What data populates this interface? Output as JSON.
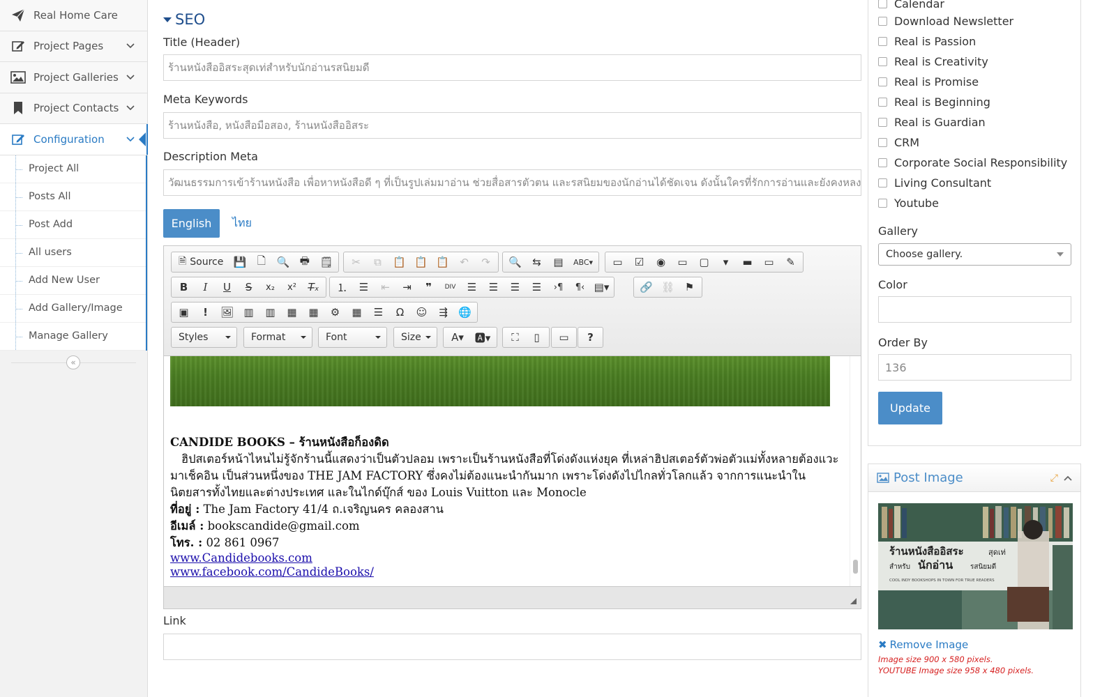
{
  "sidebar": {
    "items": [
      {
        "label": "Real Home Care",
        "icon": "paper-plane-icon",
        "chevron": false
      },
      {
        "label": "Project Pages",
        "icon": "edit-icon",
        "chevron": true
      },
      {
        "label": "Project Galleries",
        "icon": "picture-icon",
        "chevron": true
      },
      {
        "label": "Project Contacts",
        "icon": "bookmark-icon",
        "chevron": true
      },
      {
        "label": "Configuration",
        "icon": "edit-icon",
        "chevron": true,
        "active": true
      }
    ],
    "sub_items": [
      "Project All",
      "Posts All",
      "Post Add",
      "All users",
      "Add New User",
      "Add Gallery/Image",
      "Manage Gallery"
    ],
    "collapse_icon": "«"
  },
  "seo": {
    "title": "SEO",
    "title_label": "Title (Header)",
    "title_value": "ร้านหนังสืออิสระสุดเท่สำหรับนักอ่านรสนิยมดี",
    "keywords_label": "Meta Keywords",
    "keywords_value": "ร้านหนังสือ, หนังสือมือสอง, ร้านหนังสืออิสระ",
    "description_label": "Description Meta",
    "description_value": "วัฒนธรรมการเข้าร้านหนังสือ เพื่อหาหนังสือดี ๆ ที่เป็นรูปเล่มมาอ่าน ช่วยสื่อสารตัวตน และรสนิยมของนักอ่านได้ชัดเจน ดังนั้นใครที่รักการอ่านและยังคงหลงรักห"
  },
  "lang_tabs": {
    "active": "English",
    "other": "ไทย"
  },
  "editor": {
    "source_label": "Source",
    "combos": {
      "styles": "Styles",
      "format": "Format",
      "font": "Font",
      "size": "Size"
    },
    "content": {
      "heading": "CANDIDE BOOKS – ร้านหนังสือก็องดิด",
      "paragraph": "ฮิปสเตอร์หน้าไหนไม่รู้จักร้านนี้แสดงว่าเป็นตัวปลอม เพราะเป็นร้านหนังสือที่โด่งดังแห่งยุค ที่เหล่าฮิปสเตอร์ตัวพ่อตัวแม่ทั้งหลายต้องแวะมาเช็คอิน เป็นส่วนหนึ่งของ THE JAM FACTORY ซึ่งคงไม่ต้องแนะนำกันมาก เพราะโด่งดังไปไกลทั่วโลกแล้ว จากการแนะนำในนิตยสารทั้งไทยและต่างประเทศ และในไกด์บุ๊กส์ ของ Louis Vuitton และ Monocle",
      "address_label": "ที่อยู่ :",
      "address_value": "The Jam Factory 41/4 ถ.เจริญนคร คลองสาน",
      "email_label": "อีเมล์ :",
      "email_value": "bookscandide@gmail.com",
      "phone_label": "โทร. :",
      "phone_value": "02 861 0967",
      "link1": "www.Candidebooks.com",
      "link2": "www.facebook.com/CandideBooks/"
    }
  },
  "link_field": {
    "label": "Link",
    "value": ""
  },
  "right": {
    "categories": [
      "Calendar",
      "Download Newsletter",
      "Real is Passion",
      "Real is Creativity",
      "Real is Promise",
      "Real is Beginning",
      "Real is Guardian",
      "CRM",
      "Corporate Social Responsibility",
      "Living Consultant",
      "Youtube"
    ],
    "gallery_label": "Gallery",
    "gallery_value": "Choose gallery.",
    "color_label": "Color",
    "color_value": "",
    "order_label": "Order By",
    "order_value": "136",
    "update_label": "Update"
  },
  "post_image": {
    "title": "Post Image",
    "image_title": "ร้านหนังสืออิสระ",
    "image_title_small": "สุดเท่",
    "image_line2_prefix": "สำหรับ",
    "image_line2_big": "นักอ่าน",
    "image_line2_suffix": "รสนิยมดี",
    "image_caption": "COOL INDY BOOKSHOPS IN TOWN FOR TRUE READERS",
    "remove_label": "Remove Image",
    "note1": "Image size 900 x 580 pixels.",
    "note2": "YOUTUBE Image size 958 x 480 pixels."
  },
  "colors": {
    "accent": "#4b8dc8",
    "link": "#2a7bc4",
    "error": "#d62020"
  }
}
